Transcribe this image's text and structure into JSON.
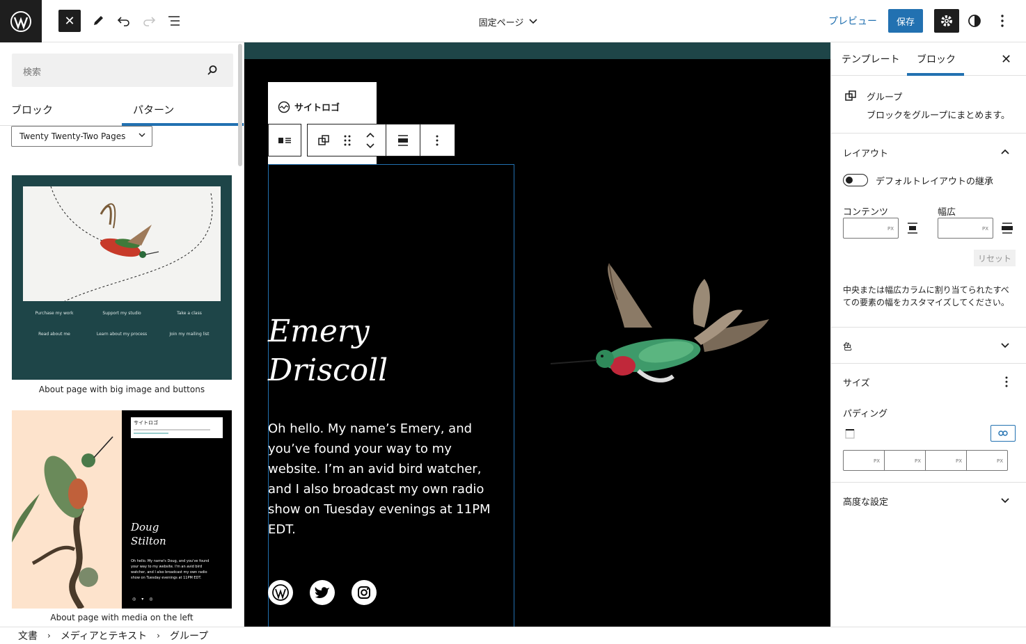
{
  "topbar": {
    "doc_title": "固定ページ",
    "preview": "プレビュー",
    "save": "保存"
  },
  "inserter": {
    "search_placeholder": "検索",
    "tabs": [
      "ブロック",
      "パターン"
    ],
    "active_tab": "パターン",
    "category_select": "Twenty Twenty-Two Pages",
    "patterns": [
      {
        "caption": "About page with big image and buttons",
        "links": [
          "Purchase my work",
          "Support my studio",
          "Take a class",
          "Read about me",
          "Learn about my process",
          "Join my mailing list"
        ]
      },
      {
        "caption": "About page with media on the left",
        "logo": "サイトロゴ",
        "name_line1": "Doug",
        "name_line2": "Stilton",
        "bio": "Oh hello. My name's Doug, and you've found your way to my website. I'm an avid bird watcher, and I also broadcast my own radio show on Tuesday evenings at 11PM EDT."
      }
    ]
  },
  "canvas": {
    "site_logo": "サイトロゴ",
    "name_line1": "Emery",
    "name_line2": "Driscoll",
    "bio": "Oh hello. My name’s Emery, and you’ve found your way to my website. I’m an avid bird watcher, and I also broadcast my own radio show on Tuesday evenings at 11PM EDT.",
    "social_icons": [
      "wordpress-icon",
      "twitter-icon",
      "instagram-icon"
    ]
  },
  "sidebar": {
    "tabs": [
      "テンプレート",
      "ブロック"
    ],
    "active_tab": "ブロック",
    "block_name": "グループ",
    "block_desc": "ブロックをグループにまとめます。",
    "layout": {
      "title": "レイアウト",
      "toggle_label": "デフォルトレイアウトの継承",
      "toggle_on": false,
      "content_label": "コンテンツ",
      "wide_label": "幅広",
      "unit": "PX",
      "reset": "リセット",
      "help": "中央または幅広カラムに割り当てられたすべての要素の幅をカスタマイズしてください。"
    },
    "color_title": "色",
    "size": {
      "title": "サイズ",
      "padding_label": "パディング",
      "unit": "PX"
    },
    "advanced_title": "高度な設定"
  },
  "breadcrumb": [
    "文書",
    "メディアとテキスト",
    "グループ"
  ],
  "colors": {
    "accent": "#2271b1",
    "dark": "#1e1e1e",
    "canvas_bg": "#000000",
    "teal": "#1e4548"
  }
}
